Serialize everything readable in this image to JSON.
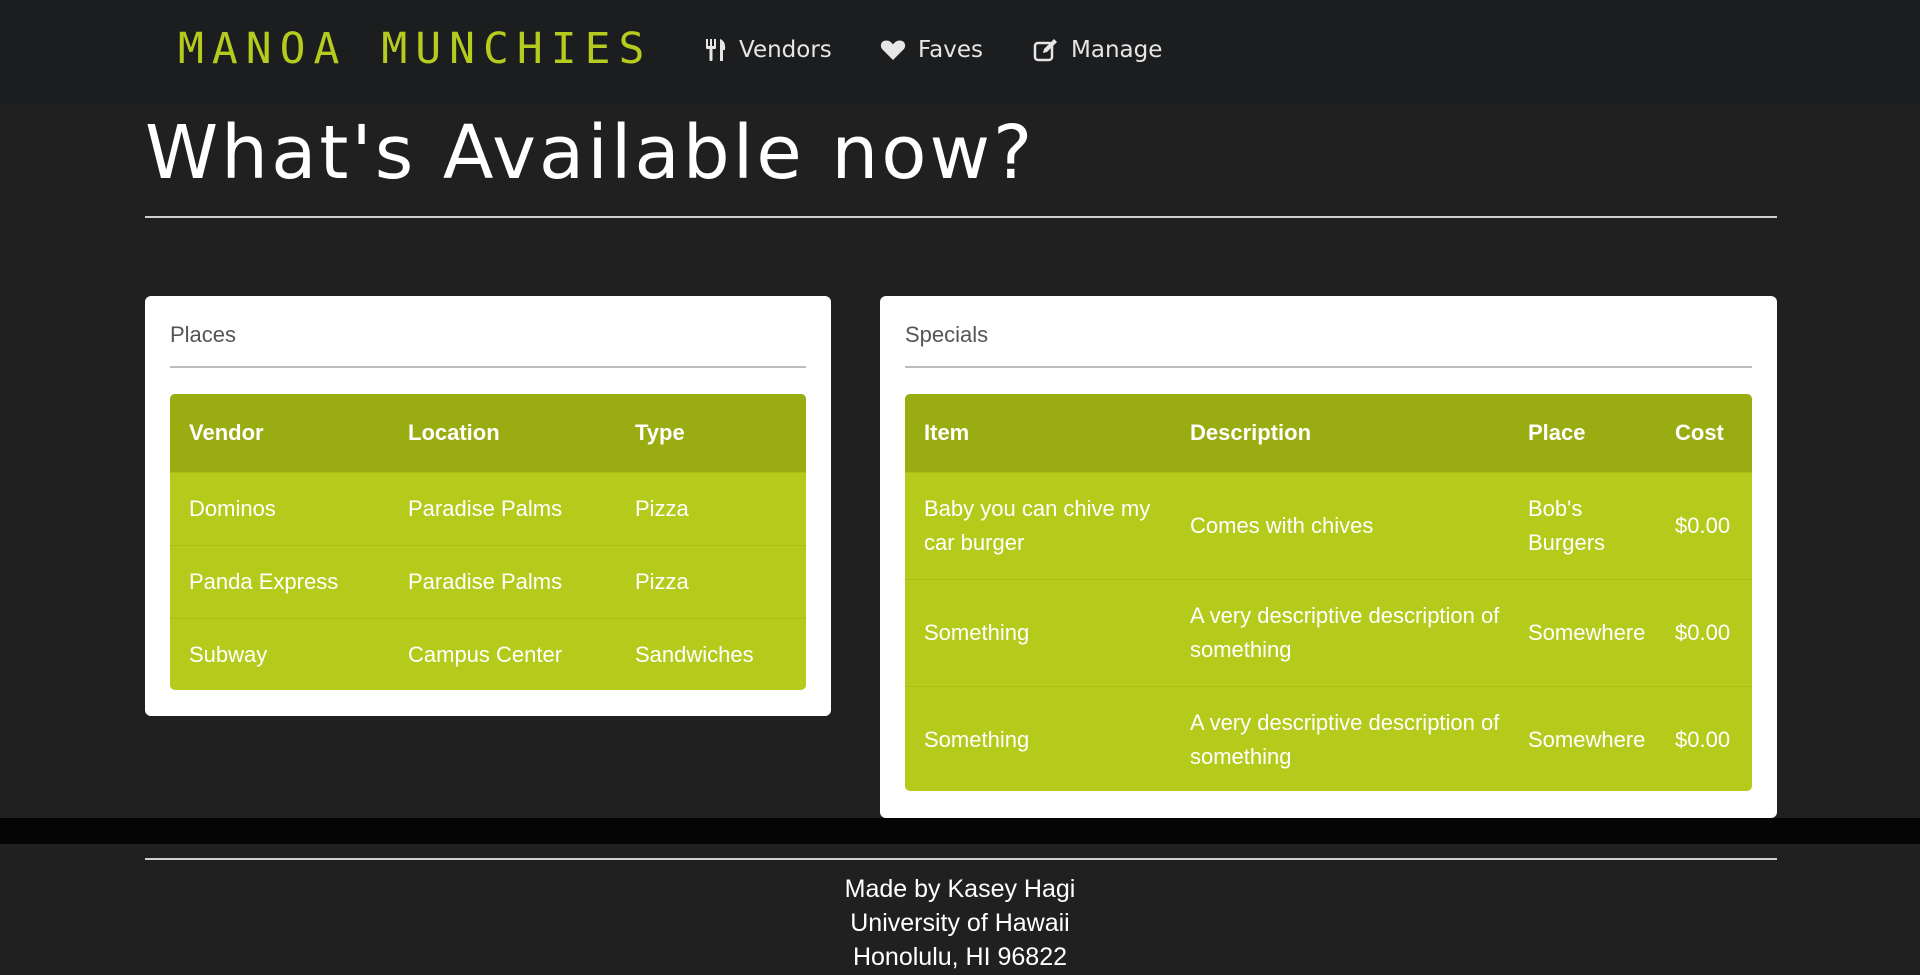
{
  "navbar": {
    "brand": "MANOA MUNCHIES",
    "items": [
      {
        "label": "Vendors",
        "icon": "utensils-icon"
      },
      {
        "label": "Faves",
        "icon": "heart-icon"
      },
      {
        "label": "Manage",
        "icon": "edit-icon"
      }
    ]
  },
  "main": {
    "title": "What's Available now?"
  },
  "places": {
    "title": "Places",
    "columns": [
      "Vendor",
      "Location",
      "Type"
    ],
    "rows": [
      [
        "Dominos",
        "Paradise Palms",
        "Pizza"
      ],
      [
        "Panda Express",
        "Paradise Palms",
        "Pizza"
      ],
      [
        "Subway",
        "Campus Center",
        "Sandwiches"
      ]
    ]
  },
  "specials": {
    "title": "Specials",
    "columns": [
      "Item",
      "Description",
      "Place",
      "Cost"
    ],
    "rows": [
      [
        "Baby you can chive my car burger",
        "Comes with chives",
        "Bob's Burgers",
        "$0.00"
      ],
      [
        "Something",
        "A very descriptive description of something",
        "Somewhere",
        "$0.00"
      ],
      [
        "Something",
        "A very descriptive description of something",
        "Somewhere",
        "$0.00"
      ]
    ]
  },
  "footer": {
    "lines": [
      "Made by Kasey Hagi",
      "University of Hawaii",
      "Honolulu, HI 96822"
    ]
  },
  "colors": {
    "accent": "#b5cb1e",
    "table_header": "#99ad12",
    "table_body": "#b4cb1c",
    "background": "#202020"
  }
}
